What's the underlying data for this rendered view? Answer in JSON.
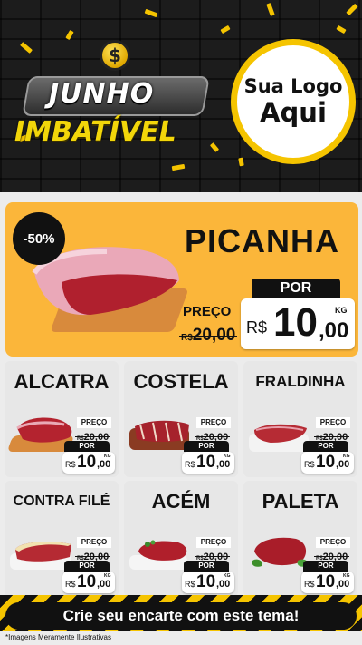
{
  "header": {
    "title_line1": "JUNHO",
    "title_line2": "IMBATÍVEL",
    "coin_symbol": "$",
    "logo_line1": "Sua Logo",
    "logo_line2": "Aqui",
    "accent_color": "#f5c400"
  },
  "hero": {
    "discount": "-50%",
    "name": "PICANHA",
    "price_label": "PREÇO",
    "old_currency": "R$",
    "old_price": "20,00",
    "por_label": "POR",
    "currency": "R$",
    "price_int": "10",
    "price_dec": ",00",
    "unit": "KG",
    "background_color": "#fbb63a"
  },
  "products": [
    {
      "name": "ALCATRA",
      "price_label": "PREÇO",
      "old_currency": "R$",
      "old_price": "20,00",
      "por_label": "POR",
      "currency": "R$",
      "price_int": "10",
      "price_dec": ",00",
      "unit": "KG"
    },
    {
      "name": "COSTELA",
      "price_label": "PREÇO",
      "old_currency": "R$",
      "old_price": "20,00",
      "por_label": "POR",
      "currency": "R$",
      "price_int": "10",
      "price_dec": ",00",
      "unit": "KG"
    },
    {
      "name": "FRALDINHA",
      "price_label": "PREÇO",
      "old_currency": "R$",
      "old_price": "20,00",
      "por_label": "POR",
      "currency": "R$",
      "price_int": "10",
      "price_dec": ",00",
      "unit": "KG"
    },
    {
      "name": "CONTRA FILÉ",
      "price_label": "PREÇO",
      "old_currency": "R$",
      "old_price": "20,00",
      "por_label": "POR",
      "currency": "R$",
      "price_int": "10",
      "price_dec": ",00",
      "unit": "KG"
    },
    {
      "name": "ACÉM",
      "price_label": "PREÇO",
      "old_currency": "R$",
      "old_price": "20,00",
      "por_label": "POR",
      "currency": "R$",
      "price_int": "10",
      "price_dec": ",00",
      "unit": "KG"
    },
    {
      "name": "PALETA",
      "price_label": "PREÇO",
      "old_currency": "R$",
      "old_price": "20,00",
      "por_label": "POR",
      "currency": "R$",
      "price_int": "10",
      "price_dec": ",00",
      "unit": "KG"
    }
  ],
  "footer": {
    "cta": "Crie seu encarte com este tema!",
    "disclaimer": "*Imagens Meramente Ilustrativas"
  }
}
